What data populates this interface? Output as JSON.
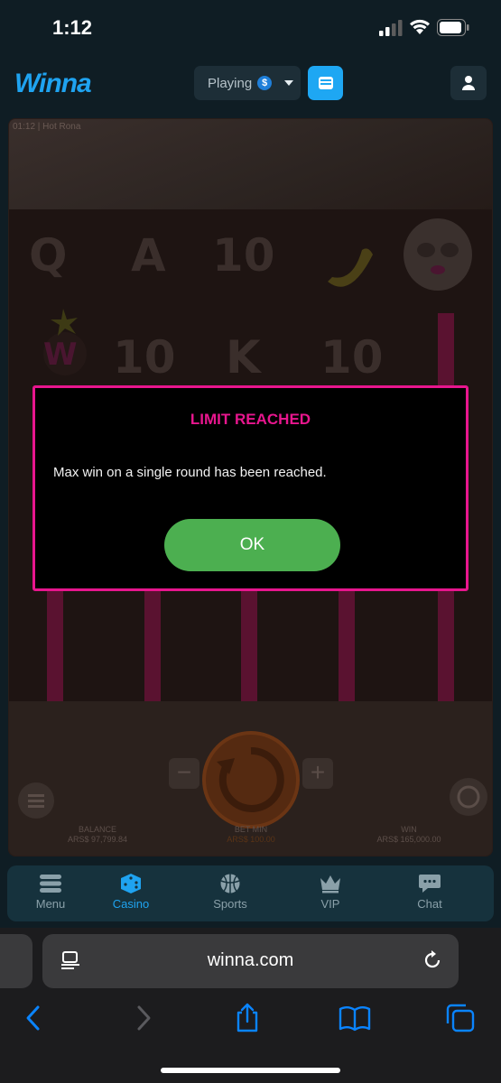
{
  "status_bar": {
    "time": "1:12"
  },
  "header": {
    "logo": "Winna",
    "playing_label": "Playing",
    "coin_symbol": "$"
  },
  "game": {
    "title_bar": "01:12 | Hot Rona",
    "reel_symbols": [
      "Q",
      "A",
      "10",
      "10",
      "K",
      "10"
    ],
    "balance_label": "BALANCE",
    "balance_value": "ARS$ 97,799.84",
    "bet_label": "BET MIN",
    "bet_value": "ARS$ 100.00",
    "win_label": "WIN",
    "win_value": "ARS$ 165,000.00"
  },
  "dialog": {
    "title": "LIMIT REACHED",
    "message": "Max win on a single round has been reached.",
    "ok_label": "OK",
    "accent_color": "#e8168e",
    "ok_color": "#4caf50"
  },
  "nav": {
    "items": [
      {
        "label": "Menu",
        "icon": "menu-icon"
      },
      {
        "label": "Casino",
        "icon": "dice-icon"
      },
      {
        "label": "Sports",
        "icon": "basketball-icon"
      },
      {
        "label": "VIP",
        "icon": "crown-icon"
      },
      {
        "label": "Chat",
        "icon": "chat-icon"
      }
    ],
    "active": "Casino"
  },
  "browser": {
    "url": "winna.com"
  }
}
